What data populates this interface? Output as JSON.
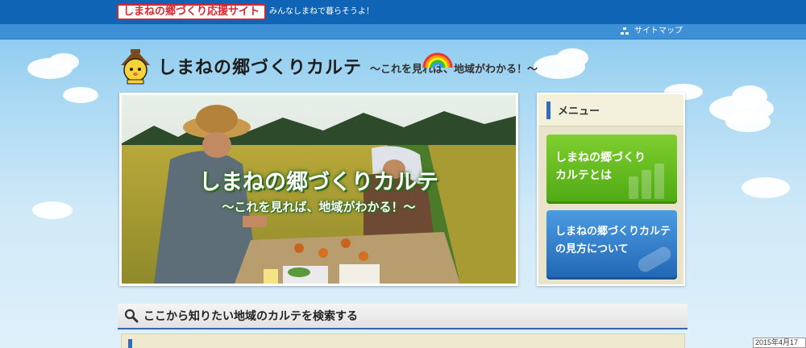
{
  "topbar": {
    "site_badge": "しまねの郷づくり応援サイト",
    "tagline": "みんなしまねで暮らそうよ！"
  },
  "subbar": {
    "sitemap_label": "サイトマップ"
  },
  "logo": {
    "title": "しまねの郷づくりカルテ",
    "subtitle": "～これを見れば、地域がわかる！～"
  },
  "hero": {
    "title": "しまねの郷づくりカルテ",
    "subtitle": "～これを見れば、地域がわかる！～"
  },
  "menu": {
    "heading": "メニュー",
    "items": [
      {
        "line1": "しまねの郷づくり",
        "line2": "カルテとは"
      },
      {
        "line1": "しまねの郷づくりカルテ",
        "line2": "の見方について"
      }
    ]
  },
  "search": {
    "heading": "ここから知りたい地域のカルテを検索する"
  },
  "footer": {
    "date": "2015年4月17日"
  },
  "colors": {
    "topbar": "#0f64b5",
    "subbar": "#3d8fd6",
    "badge_red": "#d8262d",
    "menu_green": "#5cb41b",
    "menu_blue": "#2f79c5",
    "accent_blue": "#2f6fb9"
  }
}
